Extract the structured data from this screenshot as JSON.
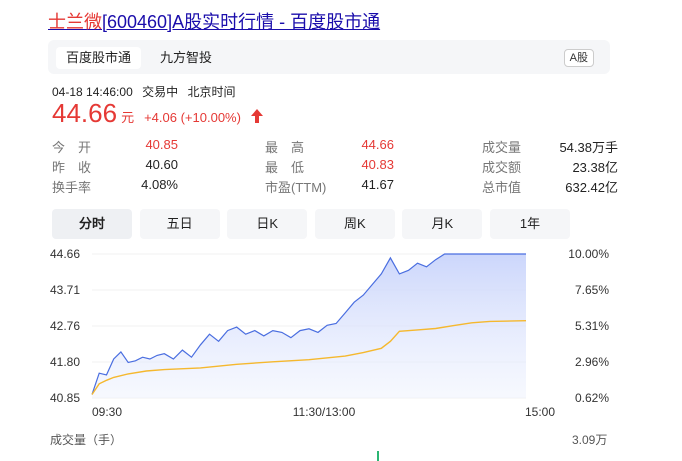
{
  "header": {
    "title_name": "士兰微",
    "title_rest": "[600460]A股实时行情 - 百度股市通"
  },
  "tabs": {
    "items": [
      "百度股市通",
      "九方智投"
    ],
    "badge": "A股"
  },
  "meta": {
    "time": "04-18 14:46:00",
    "status": "交易中",
    "timezone": "北京时间"
  },
  "price": {
    "value": "44.66",
    "unit": "元",
    "change": "+4.06 (+10.00%)",
    "up_color": "#e53935"
  },
  "stats": {
    "rows": [
      [
        {
          "label": "今　开",
          "value": "40.85",
          "red": true
        },
        {
          "label": "最　高",
          "value": "44.66",
          "red": true
        },
        {
          "label": "成交量",
          "value": "54.38万手",
          "red": false
        }
      ],
      [
        {
          "label": "昨　收",
          "value": "40.60",
          "red": false
        },
        {
          "label": "最　低",
          "value": "40.83",
          "red": true
        },
        {
          "label": "成交额",
          "value": "23.38亿",
          "red": false
        }
      ],
      [
        {
          "label": "换手率",
          "value": "4.08%",
          "red": false
        },
        {
          "label": "市盈(TTM)",
          "value": "41.67",
          "red": false
        },
        {
          "label": "总市值",
          "value": "632.42亿",
          "red": false
        }
      ]
    ]
  },
  "periods": {
    "items": [
      "分时",
      "五日",
      "日K",
      "周K",
      "月K",
      "1年"
    ],
    "active": 0
  },
  "chart_data": {
    "type": "line",
    "x_ticks": [
      "09:30",
      "11:30/13:00",
      "15:00"
    ],
    "y_ticks_left": [
      "44.66",
      "43.71",
      "42.76",
      "41.80",
      "40.85"
    ],
    "y_ticks_right": [
      "10.00%",
      "7.65%",
      "5.31%",
      "2.96%",
      "0.62%"
    ],
    "ylim": [
      40.6,
      44.66
    ],
    "x_range": [
      0,
      240
    ],
    "series": [
      {
        "role": "price",
        "color": "#4a6ee0",
        "x": [
          0,
          4,
          8,
          12,
          16,
          20,
          24,
          28,
          32,
          36,
          40,
          45,
          50,
          55,
          60,
          65,
          70,
          75,
          80,
          85,
          90,
          95,
          100,
          105,
          110,
          115,
          120,
          125,
          130,
          135,
          140,
          145,
          150,
          155,
          160,
          165,
          170,
          175,
          180,
          185,
          190,
          195,
          200,
          205,
          210,
          215,
          220,
          225,
          230,
          235,
          240
        ],
        "y": [
          40.7,
          41.3,
          41.25,
          41.7,
          41.9,
          41.6,
          41.65,
          41.75,
          41.7,
          41.8,
          41.85,
          41.7,
          41.95,
          41.75,
          42.1,
          42.4,
          42.2,
          42.5,
          42.6,
          42.4,
          42.5,
          42.35,
          42.5,
          42.45,
          42.3,
          42.5,
          42.55,
          42.45,
          42.65,
          42.7,
          43.0,
          43.3,
          43.5,
          43.8,
          44.1,
          44.55,
          44.1,
          44.2,
          44.4,
          44.3,
          44.5,
          44.66,
          44.66,
          44.66,
          44.66,
          44.66,
          44.66,
          44.66,
          44.66,
          44.66,
          44.66
        ]
      },
      {
        "role": "average",
        "color": "#f5b82e",
        "x": [
          0,
          4,
          8,
          12,
          20,
          30,
          40,
          60,
          80,
          100,
          120,
          140,
          150,
          160,
          165,
          170,
          180,
          190,
          200,
          210,
          220,
          240
        ],
        "y": [
          40.7,
          41.0,
          41.1,
          41.18,
          41.28,
          41.36,
          41.4,
          41.45,
          41.55,
          41.62,
          41.68,
          41.78,
          41.88,
          42.0,
          42.2,
          42.48,
          42.52,
          42.56,
          42.64,
          42.72,
          42.76,
          42.78
        ]
      }
    ],
    "volume": {
      "label": "成交量（手）",
      "max": "3.09万"
    }
  }
}
